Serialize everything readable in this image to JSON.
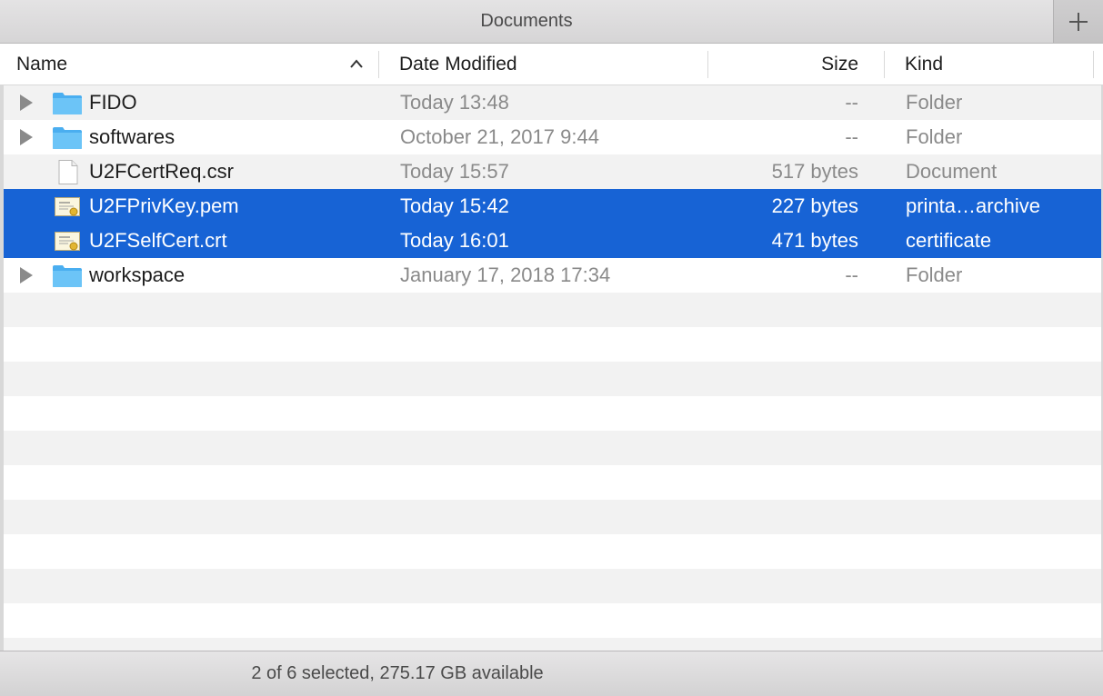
{
  "window": {
    "title": "Documents"
  },
  "columns": {
    "name": "Name",
    "date": "Date Modified",
    "size": "Size",
    "kind": "Kind",
    "sort_column": "name",
    "sort_direction": "ascending"
  },
  "files": [
    {
      "name": "FIDO",
      "date": "Today 13:48",
      "size": "--",
      "kind": "Folder",
      "icon": "folder-icon",
      "expandable": true,
      "selected": false
    },
    {
      "name": "softwares",
      "date": "October 21, 2017 9:44",
      "size": "--",
      "kind": "Folder",
      "icon": "folder-icon",
      "expandable": true,
      "selected": false
    },
    {
      "name": "U2FCertReq.csr",
      "date": "Today 15:57",
      "size": "517 bytes",
      "kind": "Document",
      "icon": "document-icon",
      "expandable": false,
      "selected": false
    },
    {
      "name": "U2FPrivKey.pem",
      "date": "Today 15:42",
      "size": "227 bytes",
      "kind": "printa…archive",
      "icon": "certificate-icon",
      "expandable": false,
      "selected": true
    },
    {
      "name": "U2FSelfCert.crt",
      "date": "Today 16:01",
      "size": "471 bytes",
      "kind": "certificate",
      "icon": "certificate-icon",
      "expandable": false,
      "selected": true
    },
    {
      "name": "workspace",
      "date": "January 17, 2018 17:34",
      "size": "--",
      "kind": "Folder",
      "icon": "folder-icon",
      "expandable": true,
      "selected": false
    }
  ],
  "status": {
    "text": "2 of 6 selected, 275.17 GB available"
  },
  "colors": {
    "selection": "#1763d5",
    "folder": "#5bb8f2",
    "stripe": "#f2f2f2"
  }
}
